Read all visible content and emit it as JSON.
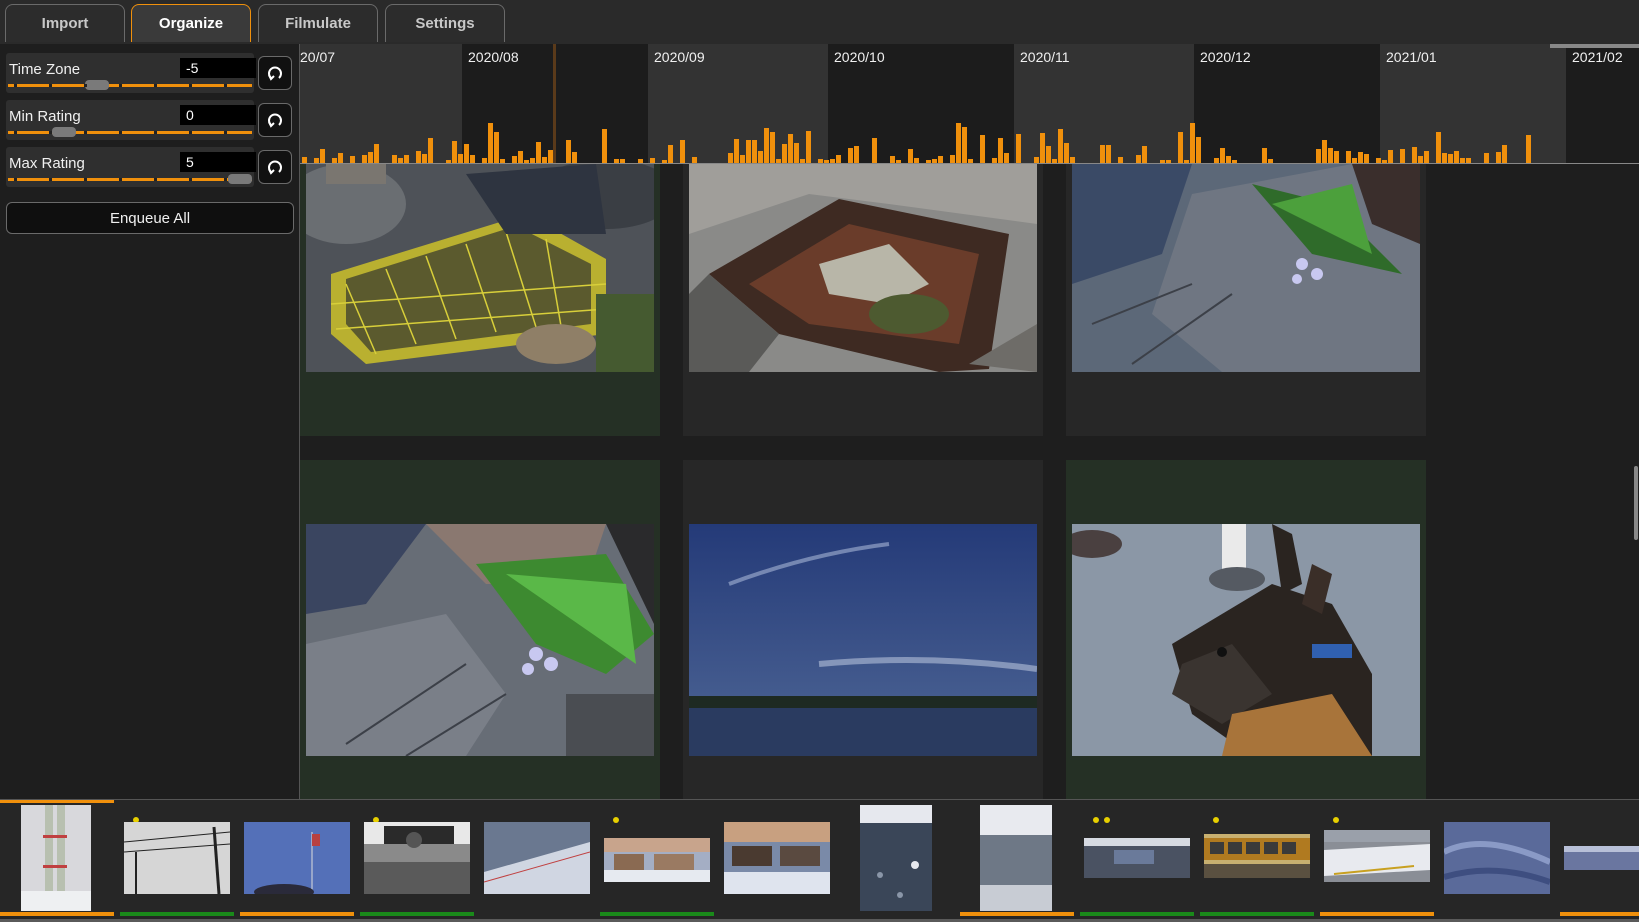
{
  "tabs": [
    {
      "label": "Import",
      "active": false
    },
    {
      "label": "Organize",
      "active": true
    },
    {
      "label": "Filmulate",
      "active": false
    },
    {
      "label": "Settings",
      "active": false
    }
  ],
  "sidebar": {
    "sliders": [
      {
        "label": "Time Zone",
        "value": "-5",
        "level": 0.35
      },
      {
        "label": "Min Rating",
        "value": "0",
        "level": 0.2
      },
      {
        "label": "Max Rating",
        "value": "5",
        "level": 1.0
      }
    ],
    "enqueue_label": "Enqueue All"
  },
  "timeline": {
    "months": [
      "20/07",
      "2020/08",
      "2020/09",
      "2020/10",
      "2020/11",
      "2020/12",
      "2021/01",
      "2021/02"
    ]
  },
  "grid": {
    "photos": [
      {
        "name": "lobster-trap-photo"
      },
      {
        "name": "tide-pool-photo"
      },
      {
        "name": "rock-flowers-photo"
      },
      {
        "name": "rock-flowers-closeup-photo"
      },
      {
        "name": "lake-sky-photo"
      },
      {
        "name": "german-shepherd-photo"
      }
    ],
    "load_progress": 0.2
  },
  "filmstrip": {
    "thumbnails": [
      {
        "name": "snow-pipes-thumb",
        "rating": 0,
        "bar": "orange"
      },
      {
        "name": "power-lines-thumb",
        "rating": 1,
        "bar": "green"
      },
      {
        "name": "flag-sky-thumb",
        "rating": 0,
        "bar": "orange"
      },
      {
        "name": "car-snow-thumb",
        "rating": 1,
        "bar": "green"
      },
      {
        "name": "snow-field-thumb",
        "rating": 0,
        "bar": "none"
      },
      {
        "name": "houses-snow-thumb",
        "rating": 1,
        "bar": "green"
      },
      {
        "name": "houses-dusk-thumb",
        "rating": 0,
        "bar": "none"
      },
      {
        "name": "icy-ground-thumb",
        "rating": 0,
        "bar": "none"
      },
      {
        "name": "snow-lot-thumb",
        "rating": 0,
        "bar": "orange"
      },
      {
        "name": "puddle-thumb",
        "rating": 2,
        "bar": "green"
      },
      {
        "name": "school-bus-thumb",
        "rating": 1,
        "bar": "green"
      },
      {
        "name": "snow-curb-thumb",
        "rating": 1,
        "bar": "orange"
      },
      {
        "name": "ice-sheet-thumb",
        "rating": 0,
        "bar": "none"
      },
      {
        "name": "ice-edge-thumb",
        "rating": 0,
        "bar": "orange"
      }
    ]
  },
  "colors": {
    "accent": "#f0900c",
    "rated_bar": "#1a8a1a",
    "background": "#1e1e1e"
  }
}
